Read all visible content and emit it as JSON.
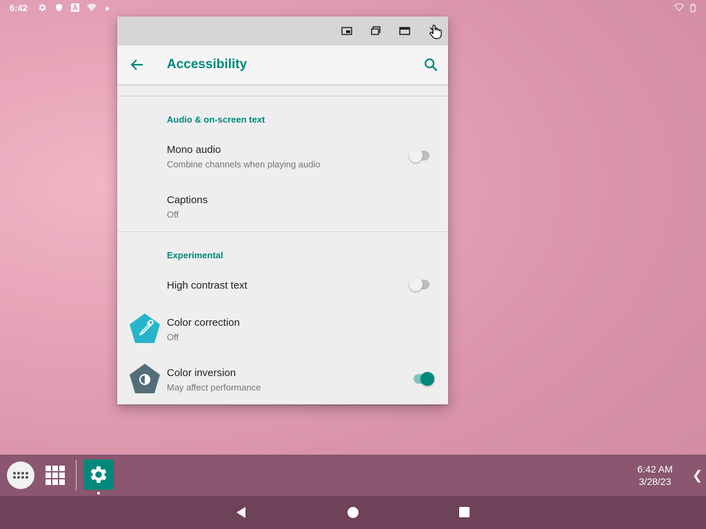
{
  "status_bar": {
    "time": "6:42",
    "left_icons": [
      "gear-icon",
      "shield-icon",
      "a-letter-icon",
      "wifi-icon"
    ],
    "right_icons": [
      "signal-icon",
      "battery-icon"
    ]
  },
  "window": {
    "caption_buttons": [
      "picture-in-picture-icon",
      "restore-icon",
      "maximize-icon",
      "close-icon"
    ]
  },
  "app_bar": {
    "title": "Accessibility"
  },
  "sections": [
    {
      "header": "Audio & on-screen text",
      "items": [
        {
          "title": "Mono audio",
          "summary": "Combine channels when playing audio",
          "switch": false
        },
        {
          "title": "Captions",
          "summary": "Off"
        }
      ]
    },
    {
      "header": "Experimental",
      "items": [
        {
          "title": "High contrast text",
          "switch": false
        },
        {
          "title": "Color correction",
          "summary": "Off",
          "icon": "eyedropper-icon",
          "icon_color": "#26b5c9"
        },
        {
          "title": "Color inversion",
          "summary": "May affect performance",
          "switch": true,
          "icon": "contrast-icon",
          "icon_color": "#546e7a"
        }
      ]
    }
  ],
  "taskbar": {
    "clock_time": "6:42 AM",
    "clock_date": "3/28/23",
    "tray_chevron": "❮"
  },
  "colors": {
    "accent": "#00897b",
    "taskbar": "#8a5670",
    "navbar": "#6e4258"
  }
}
